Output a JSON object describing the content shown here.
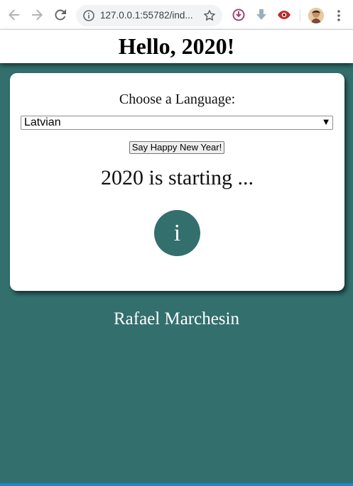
{
  "browser": {
    "url": "127.0.0.1:55782/ind...",
    "extensions": [
      "download-circle-icon",
      "download-arrow-icon",
      "eye-icon"
    ]
  },
  "page": {
    "heading": "Hello, 2020!",
    "choose_label": "Choose a Language:",
    "language_select": {
      "selected": "Latvian"
    },
    "say_button_label": "Say Happy New Year!",
    "status_text": "2020 is starting ...",
    "info_button_label": "i",
    "author": "Rafael Marchesin"
  },
  "colors": {
    "background": "#326f6d",
    "card": "#ffffff",
    "info_circle": "#326f6d"
  }
}
